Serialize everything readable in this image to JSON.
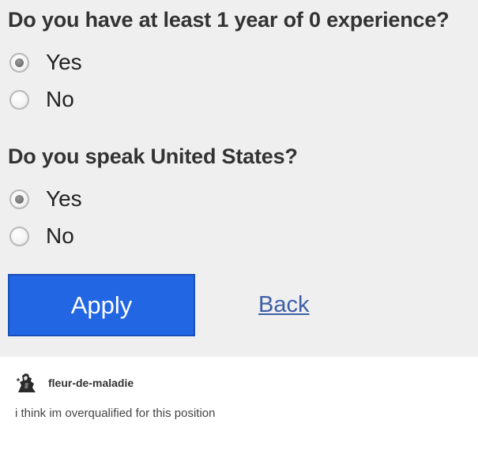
{
  "form": {
    "questions": [
      {
        "text": "Do you have at least 1 year of 0 experience?",
        "options": [
          {
            "label": "Yes",
            "selected": true
          },
          {
            "label": "No",
            "selected": false
          }
        ]
      },
      {
        "text": "Do you speak United States?",
        "options": [
          {
            "label": "Yes",
            "selected": true
          },
          {
            "label": "No",
            "selected": false
          }
        ]
      }
    ],
    "apply_label": "Apply",
    "back_label": "Back"
  },
  "post": {
    "username": "fleur-de-maladie",
    "avatar_icon": "avatar-icon",
    "text": "i think im overqualified for this position"
  },
  "colors": {
    "form_background": "#efefef",
    "apply_button": "#2266e4",
    "back_link": "#3d5fa8"
  }
}
